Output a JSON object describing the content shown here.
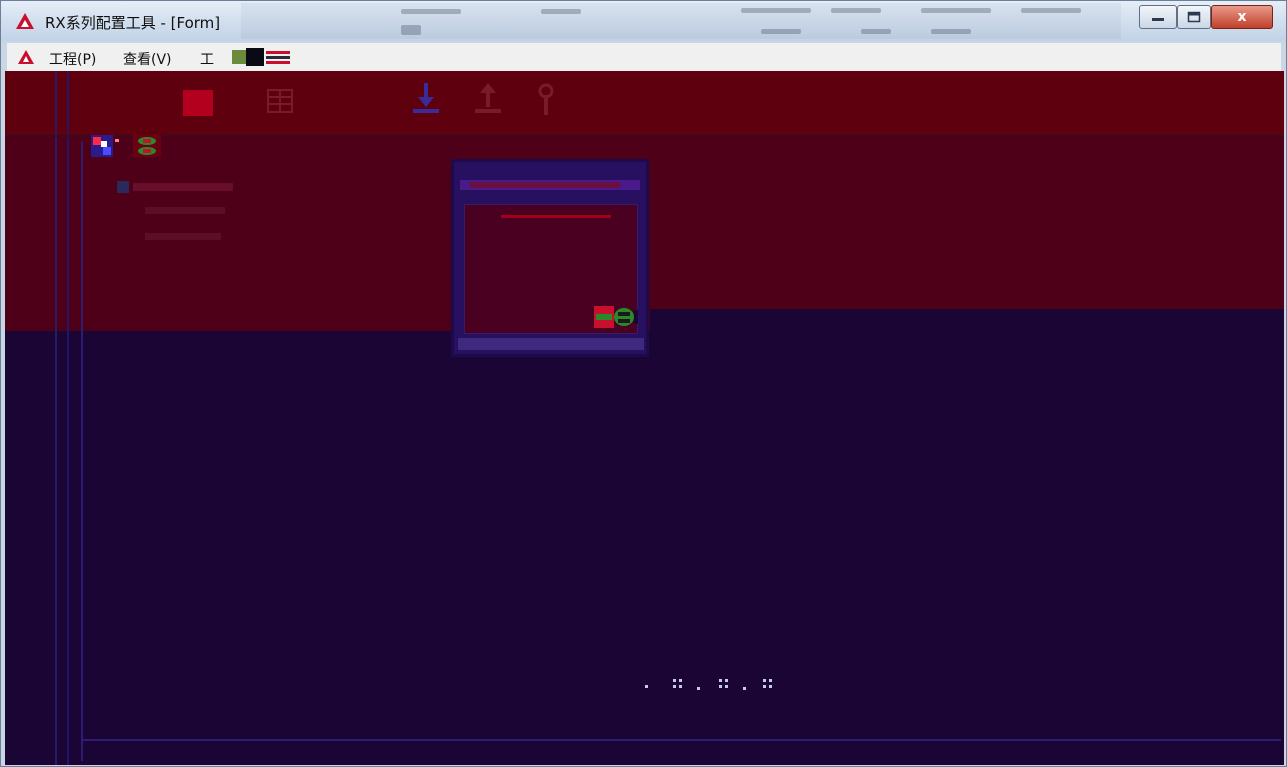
{
  "window": {
    "title": "RX系列配置工具 - [Form]",
    "controls": {
      "minimize": "minimize",
      "maximize": "maximize",
      "close": "x"
    }
  },
  "menu": {
    "items": [
      "工程(P)",
      "查看(V)",
      "工"
    ]
  },
  "colors": {
    "logo": "#c8102e",
    "client_background": "#1a0534",
    "toolbar_band": "#5f000e",
    "upper_panel": "#4d0018"
  },
  "icons": {
    "toolbar": [
      "stop-icon",
      "grid-icon",
      "download-icon",
      "upload-icon",
      "antenna-icon"
    ],
    "tree": [
      "device-icon",
      "network-icon"
    ],
    "dialog": [
      "connect-icon"
    ]
  }
}
